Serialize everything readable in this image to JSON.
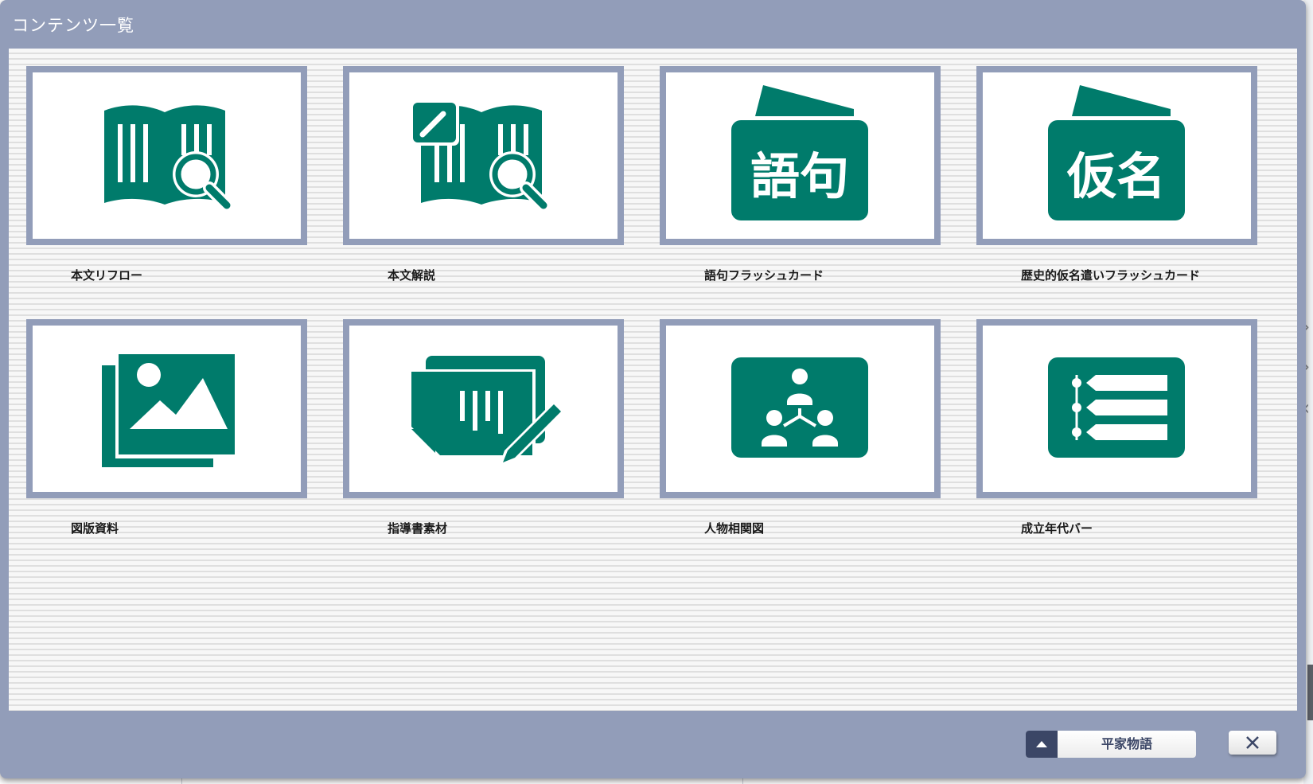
{
  "dialog": {
    "title": "コンテンツ一覧"
  },
  "colors": {
    "frame": "#929db9",
    "icon": "#007b6b",
    "button_dark": "#3b4666"
  },
  "tiles": [
    {
      "label": "本文リフロー",
      "icon": "book-search-icon"
    },
    {
      "label": "本文解説",
      "icon": "book-edit-search-icon"
    },
    {
      "label": "語句フラッシュカード",
      "icon": "flashcard-icon",
      "icon_text": "語句"
    },
    {
      "label": "歴史的仮名遣いフラッシュカード",
      "icon": "flashcard-icon",
      "icon_text": "仮名"
    },
    {
      "label": "図版資料",
      "icon": "image-gallery-icon"
    },
    {
      "label": "指導書素材",
      "icon": "teacher-material-icon"
    },
    {
      "label": "人物相関図",
      "icon": "org-chart-icon"
    },
    {
      "label": "成立年代バー",
      "icon": "timeline-icon"
    }
  ],
  "footer": {
    "work_selector_label": "平家物語",
    "work_selector_icon": "triangle-up-icon",
    "close_icon": "close-icon"
  }
}
